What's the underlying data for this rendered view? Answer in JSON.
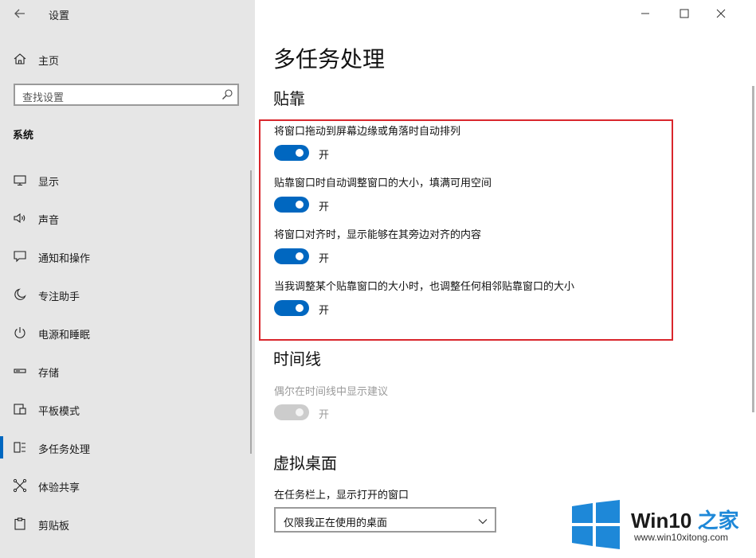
{
  "window": {
    "title": "设置"
  },
  "sidebar": {
    "home_label": "主页",
    "search": {
      "placeholder": "查找设置"
    },
    "section_label": "系统",
    "items": [
      {
        "label": "显示",
        "icon": "display-icon"
      },
      {
        "label": "声音",
        "icon": "speaker-icon"
      },
      {
        "label": "通知和操作",
        "icon": "notification-icon"
      },
      {
        "label": "专注助手",
        "icon": "moon-icon"
      },
      {
        "label": "电源和睡眠",
        "icon": "power-icon"
      },
      {
        "label": "存储",
        "icon": "storage-icon"
      },
      {
        "label": "平板模式",
        "icon": "tablet-icon"
      },
      {
        "label": "多任务处理",
        "icon": "multitask-icon",
        "active": true
      },
      {
        "label": "体验共享",
        "icon": "share-icon"
      },
      {
        "label": "剪贴板",
        "icon": "clipboard-icon"
      }
    ]
  },
  "main": {
    "page_title": "多任务处理",
    "snap": {
      "heading": "贴靠",
      "options": [
        {
          "label": "将窗口拖动到屏幕边缘或角落时自动排列",
          "state": "开",
          "on": true
        },
        {
          "label": "贴靠窗口时自动调整窗口的大小，填满可用空间",
          "state": "开",
          "on": true
        },
        {
          "label": "将窗口对齐时，显示能够在其旁边对齐的内容",
          "state": "开",
          "on": true
        },
        {
          "label": "当我调整某个贴靠窗口的大小时，也调整任何相邻贴靠窗口的大小",
          "state": "开",
          "on": true
        }
      ]
    },
    "timeline": {
      "heading": "时间线",
      "option": {
        "label": "偶尔在时间线中显示建议",
        "state": "开",
        "on": true,
        "disabled": true
      }
    },
    "virtual_desktops": {
      "heading": "虚拟桌面",
      "taskbar_label": "在任务栏上，显示打开的窗口",
      "taskbar_value": "仅限我正在使用的桌面"
    }
  },
  "colors": {
    "accent": "#0067c0",
    "highlight_box": "#d9262c",
    "sidebar_bg": "#e6e6e6"
  },
  "watermark": {
    "brand_win": "Win10",
    "brand_zhi": "之家",
    "url": "www.win10xitong.com"
  }
}
